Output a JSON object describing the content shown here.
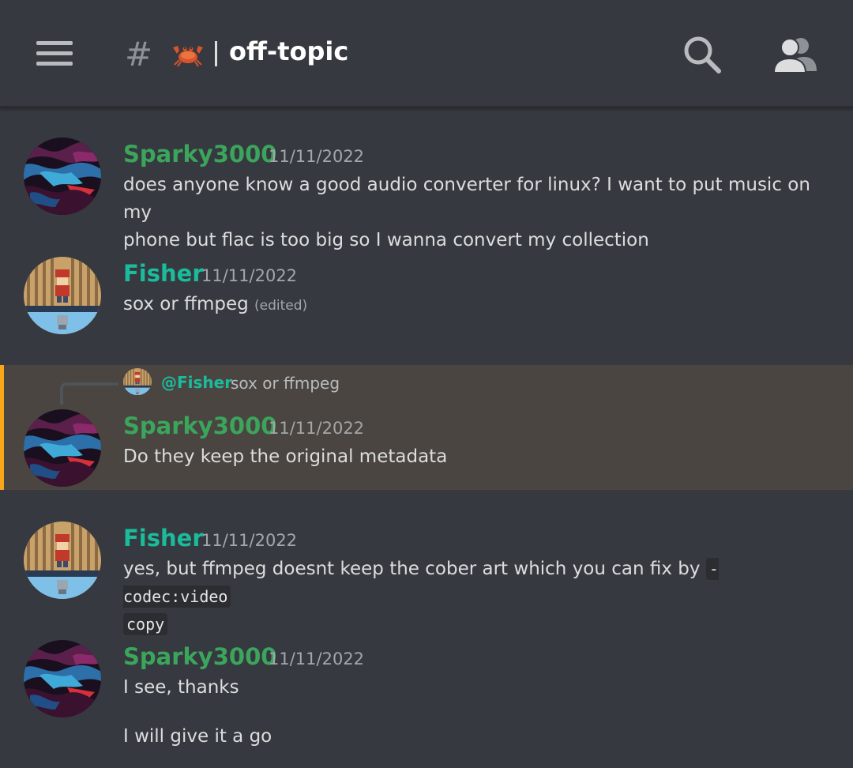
{
  "header": {
    "hash": "#",
    "channel_name": "off-topic",
    "icons": [
      "hamburger-menu-icon",
      "crab-emoji-icon",
      "search-icon",
      "members-icon"
    ]
  },
  "colors": {
    "background": "#36393f",
    "sparky_name": "#3ba55c",
    "fisher_name": "#1abc9c",
    "mention_highlight": "#4a4540",
    "mention_bar": "#faa61a"
  },
  "messages": [
    {
      "author": "Sparky3000",
      "timestamp": "11/11/2022",
      "lines": [
        "does anyone know a good audio converter for linux? I want to put music on my",
        "phone but flac is too big so I wanna convert my collection"
      ]
    },
    {
      "author": "Fisher",
      "timestamp": "11/11/2022",
      "text": "sox or ffmpeg",
      "edited": "(edited)"
    },
    {
      "reply_to": {
        "author": "@Fisher",
        "text": "sox or ffmpeg"
      },
      "author": "Sparky3000",
      "timestamp": "11/11/2022",
      "text": "Do they keep the original metadata"
    },
    {
      "author": "Fisher",
      "timestamp": "11/11/2022",
      "text_before": "yes, but ffmpeg doesnt keep the cober art which you can fix by",
      "code_1": "-codec:video",
      "code_2": "copy"
    },
    {
      "author": "Sparky3000",
      "timestamp": "11/11/2022",
      "text": "I see, thanks",
      "text_2": "I will give it a go"
    }
  ]
}
